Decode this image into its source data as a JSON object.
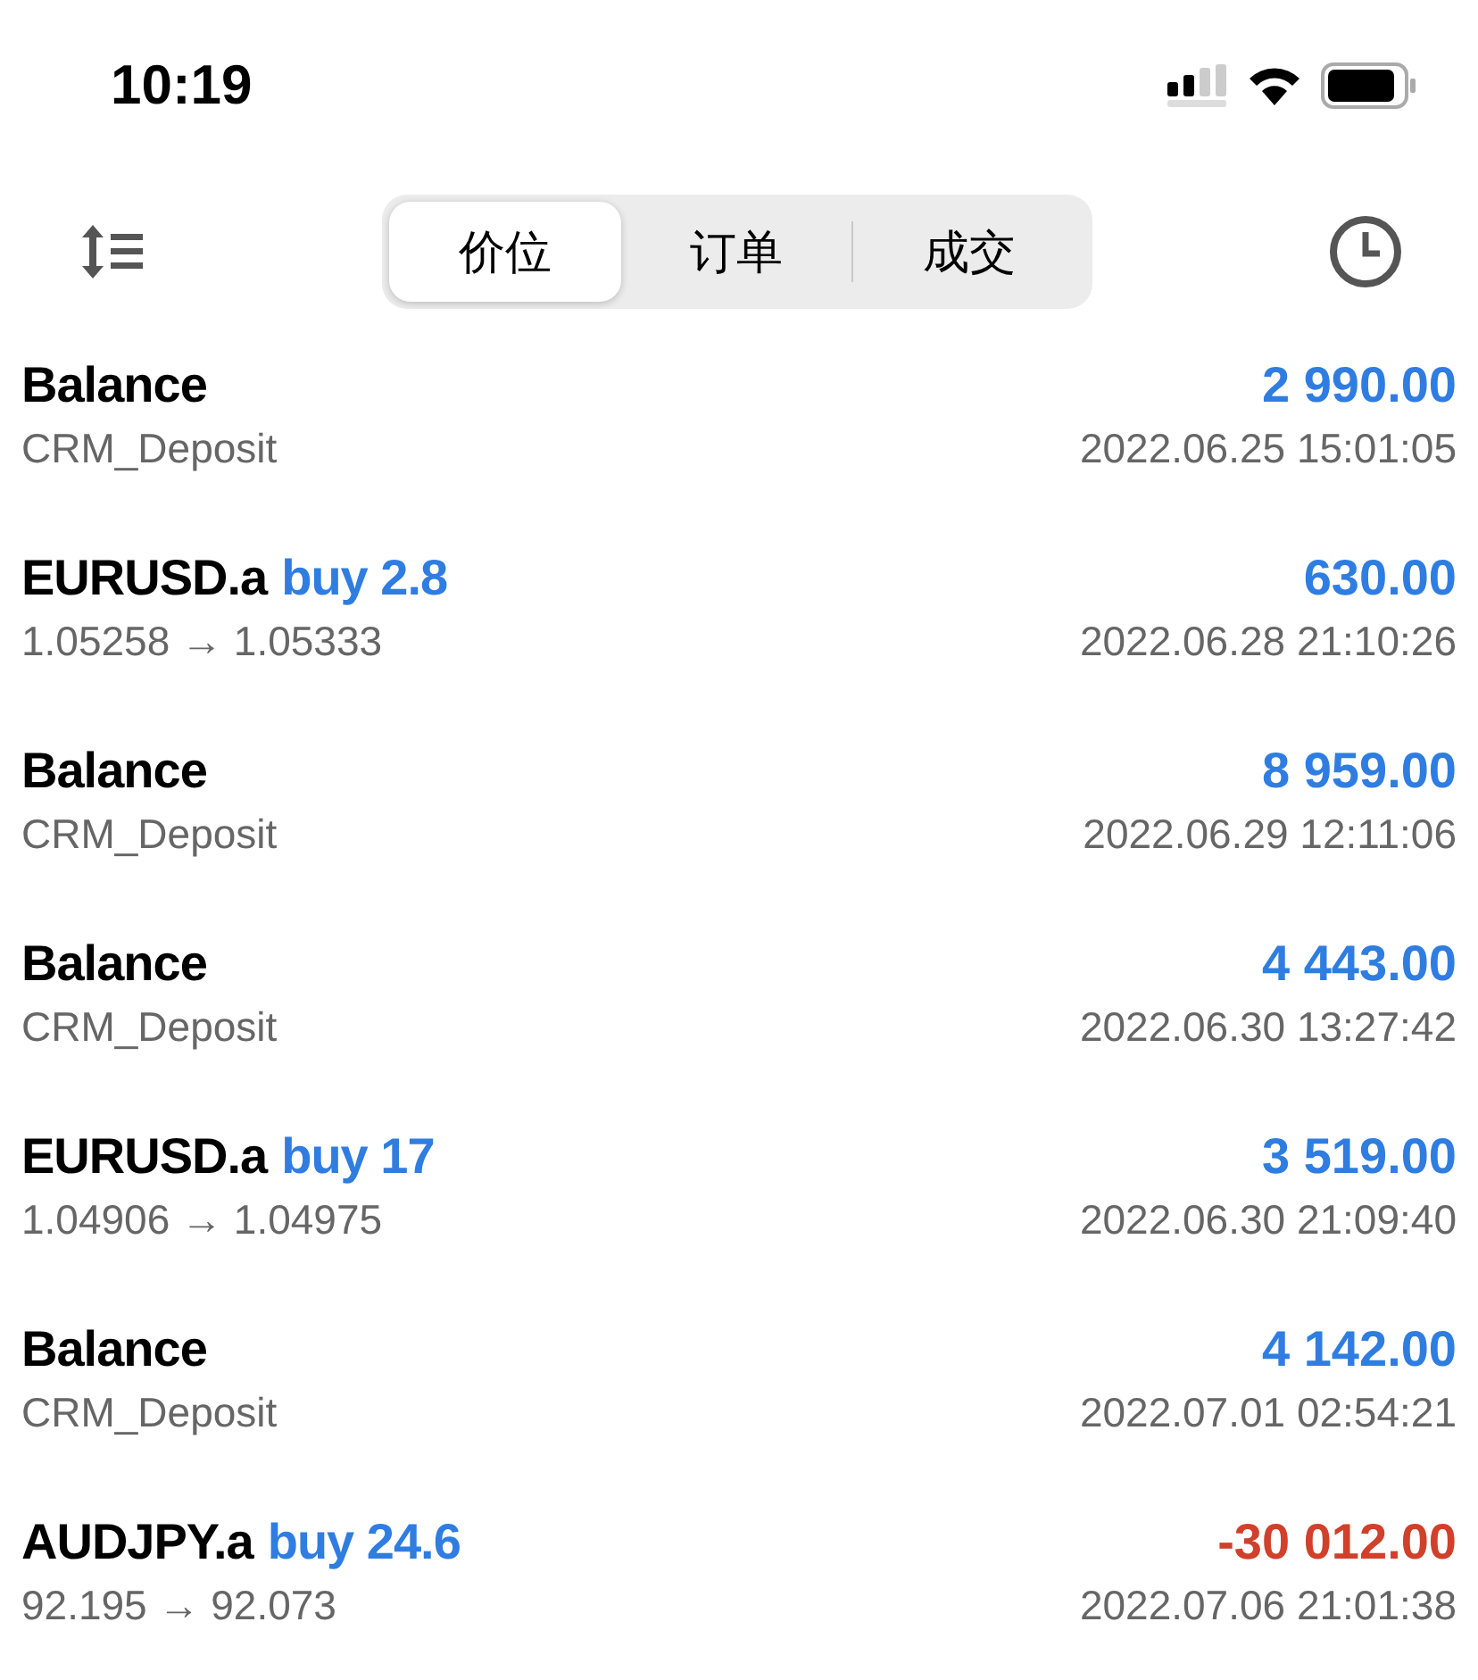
{
  "status_bar": {
    "time": "10:19"
  },
  "tabs": [
    {
      "label": "价位",
      "selected": true
    },
    {
      "label": "订单",
      "selected": false
    },
    {
      "label": "成交",
      "selected": false
    }
  ],
  "deals": [
    {
      "symbol": "Balance",
      "profit": "2 990.00",
      "color": "#2f7de1",
      "comment": "CRM_Deposit",
      "time": "2022.06.25 15:01:05"
    },
    {
      "symbol": "EURUSD.a",
      "trade": "buy 2.8",
      "profit": "630.00",
      "color": "#2f7de1",
      "comment": "1.05258 → 1.05333",
      "time": "2022.06.28 21:10:26"
    },
    {
      "symbol": "Balance",
      "profit": "8 959.00",
      "color": "#2f7de1",
      "comment": "CRM_Deposit",
      "time": "2022.06.29 12:11:06"
    },
    {
      "symbol": "Balance",
      "profit": "4 443.00",
      "color": "#2f7de1",
      "comment": "CRM_Deposit",
      "time": "2022.06.30 13:27:42"
    },
    {
      "symbol": "EURUSD.a",
      "trade": "buy 17",
      "profit": "3 519.00",
      "color": "#2f7de1",
      "comment": "1.04906 → 1.04975",
      "time": "2022.06.30 21:09:40"
    },
    {
      "symbol": "Balance",
      "profit": "4 142.00",
      "color": "#2f7de1",
      "comment": "CRM_Deposit",
      "time": "2022.07.01 02:54:21"
    },
    {
      "symbol": "AUDJPY.a",
      "trade": "buy 24.6",
      "profit": "-30 012.00",
      "color": "#d0402b",
      "comment": "92.195 → 92.073",
      "time": "2022.07.06 21:01:38"
    }
  ]
}
